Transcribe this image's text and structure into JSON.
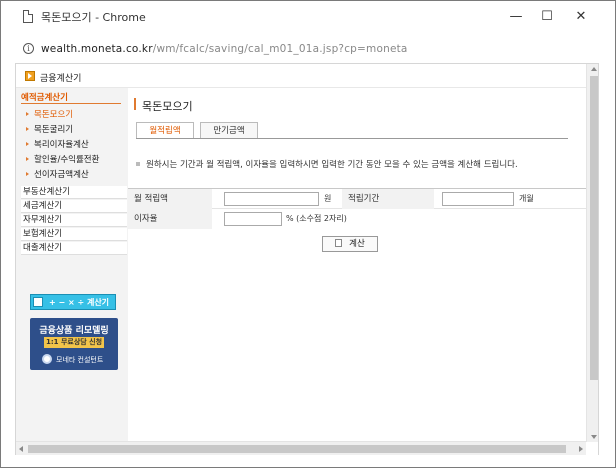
{
  "window": {
    "title": "목돈모으기 - Chrome",
    "minimize_glyph": "—",
    "maximize_glyph": "☐",
    "close_glyph": "✕",
    "url_host": "wealth.moneta.co.kr",
    "url_path": "/wm/fcalc/saving/cal_m01_01a.jsp?cp=moneta"
  },
  "top": {
    "label": "금융계산기"
  },
  "sidebar": {
    "header": "예적금계산기",
    "sub_items": [
      {
        "label": "목돈모으기",
        "active": true
      },
      {
        "label": "목돈굴리기",
        "active": false
      },
      {
        "label": "복리이자율계산",
        "active": false
      },
      {
        "label": "할인율/수익률전환",
        "active": false
      },
      {
        "label": "선이자금액계산",
        "active": false
      }
    ],
    "categories": [
      "부동산계산기",
      "세금계산기",
      "자무계산기",
      "보험계산기",
      "대출계산기"
    ],
    "calc_button_label": "+ − × ÷ 계산기",
    "promo": {
      "line1": "금융상품 리모델링",
      "line2": "1:1 무료상담 신청",
      "line3": "모네타 컨설턴트"
    }
  },
  "main": {
    "title": "목돈모으기",
    "tabs": [
      {
        "label": "월적립액",
        "active": true
      },
      {
        "label": "만기금액",
        "active": false
      }
    ],
    "description": "원하시는 기간과 월 적립액, 이자율을 입력하시면 입력한 기간 동안 모을 수 있는 금액을 계산해 드립니다.",
    "form": {
      "monthly_label": "월 적립액",
      "monthly_value": "",
      "monthly_unit": "원",
      "period_label": "적립기간",
      "period_value": "",
      "period_unit": "개월",
      "rate_label": "이자율",
      "rate_value": "",
      "rate_unit": "% (소수점 2자리)"
    },
    "calc_button": "계산"
  },
  "colors": {
    "accent": "#e05a00",
    "promo_bg": "#2e4f8a",
    "calc_button_bg": "#36c0e6"
  }
}
